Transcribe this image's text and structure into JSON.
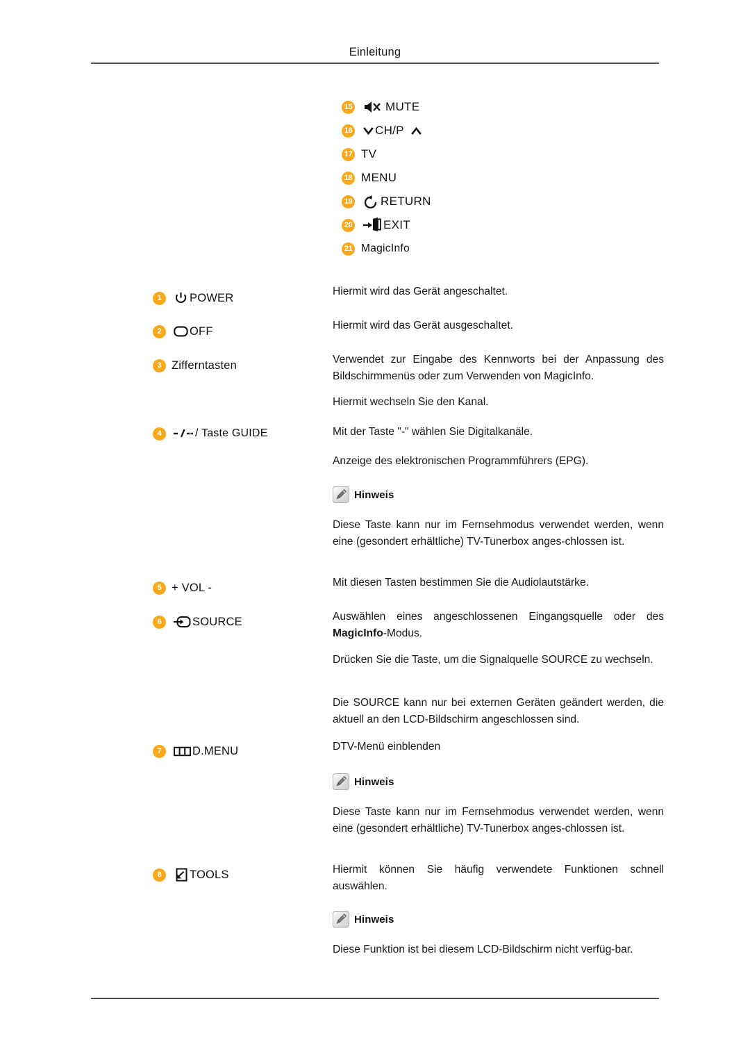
{
  "header": {
    "title": "Einleitung"
  },
  "legend": {
    "rows": [
      {
        "num": "15",
        "icon": "mute-icon",
        "label": "MUTE"
      },
      {
        "num": "16",
        "icon": "chp-icon",
        "label": "CH/P"
      },
      {
        "num": "17",
        "icon": "",
        "label": "TV"
      },
      {
        "num": "18",
        "icon": "",
        "label": "MENU"
      },
      {
        "num": "19",
        "icon": "return-icon",
        "label": "RETURN"
      },
      {
        "num": "20",
        "icon": "exit-icon",
        "label": "EXIT"
      },
      {
        "num": "21",
        "icon": "",
        "label": "MagicInfo"
      }
    ]
  },
  "items": [
    {
      "num": "1",
      "icon": "power-icon",
      "label": "POWER"
    },
    {
      "num": "2",
      "icon": "off-icon",
      "label": "OFF"
    },
    {
      "num": "3",
      "icon": "",
      "label": "Zifferntasten"
    },
    {
      "num": "4",
      "icon": "guide-icon",
      "label": "/ Taste GUIDE",
      "icon_text": "-/--"
    },
    {
      "num": "5",
      "icon": "",
      "label": "+ VOL -"
    },
    {
      "num": "6",
      "icon": "source-icon",
      "label": "SOURCE"
    },
    {
      "num": "7",
      "icon": "dmenu-icon",
      "label": "D.MENU"
    },
    {
      "num": "8",
      "icon": "tools-icon",
      "label": "TOOLS"
    }
  ],
  "descriptions": {
    "power": "Hiermit wird das Gerät angeschaltet.",
    "off": "Hiermit wird das Gerät ausgeschaltet.",
    "digits": "Verwendet zur Eingabe des Kennworts bei der Anpassung des Bildschirmmenüs oder zum Verwenden von MagicInfo.",
    "channel": "Hiermit wechseln Sie den Kanal.",
    "digital_channels": "Mit der Taste \"-\" wählen Sie Digitalkanäle.",
    "epg": "Anzeige des elektronischen Programmführers (EPG).",
    "volume": "Mit diesen Tasten bestimmen Sie die Audiolautstärke.",
    "source_1_prefix": "Auswählen eines angeschlossenen Eingangsquelle oder des ",
    "source_1_bold": "MagicInfo",
    "source_1_suffix": "-Modus.",
    "source_2": "Drücken Sie die Taste, um die Signalquelle SOURCE zu wechseln.",
    "source_3": "Die SOURCE kann nur bei externen Geräten geändert werden, die aktuell an den LCD-Bildschirm angeschlossen sind.",
    "dmenu": "DTV-Menü einblenden",
    "tools": "Hiermit können Sie häufig verwendete Funktionen schnell auswählen."
  },
  "notes": {
    "label": "Hinweis",
    "tuner_note": "Diese Taste kann nur im Fernsehmodus verwendet werden, wenn eine (gesondert erhältliche) TV-Tunerbox anges-chlossen ist.",
    "tools_note": "Diese Funktion ist bei diesem LCD-Bildschirm nicht verfüg-bar."
  },
  "colors": {
    "badge": "#F9A81A",
    "rule": "#4a4a4a",
    "text": "#1a1a1a"
  }
}
